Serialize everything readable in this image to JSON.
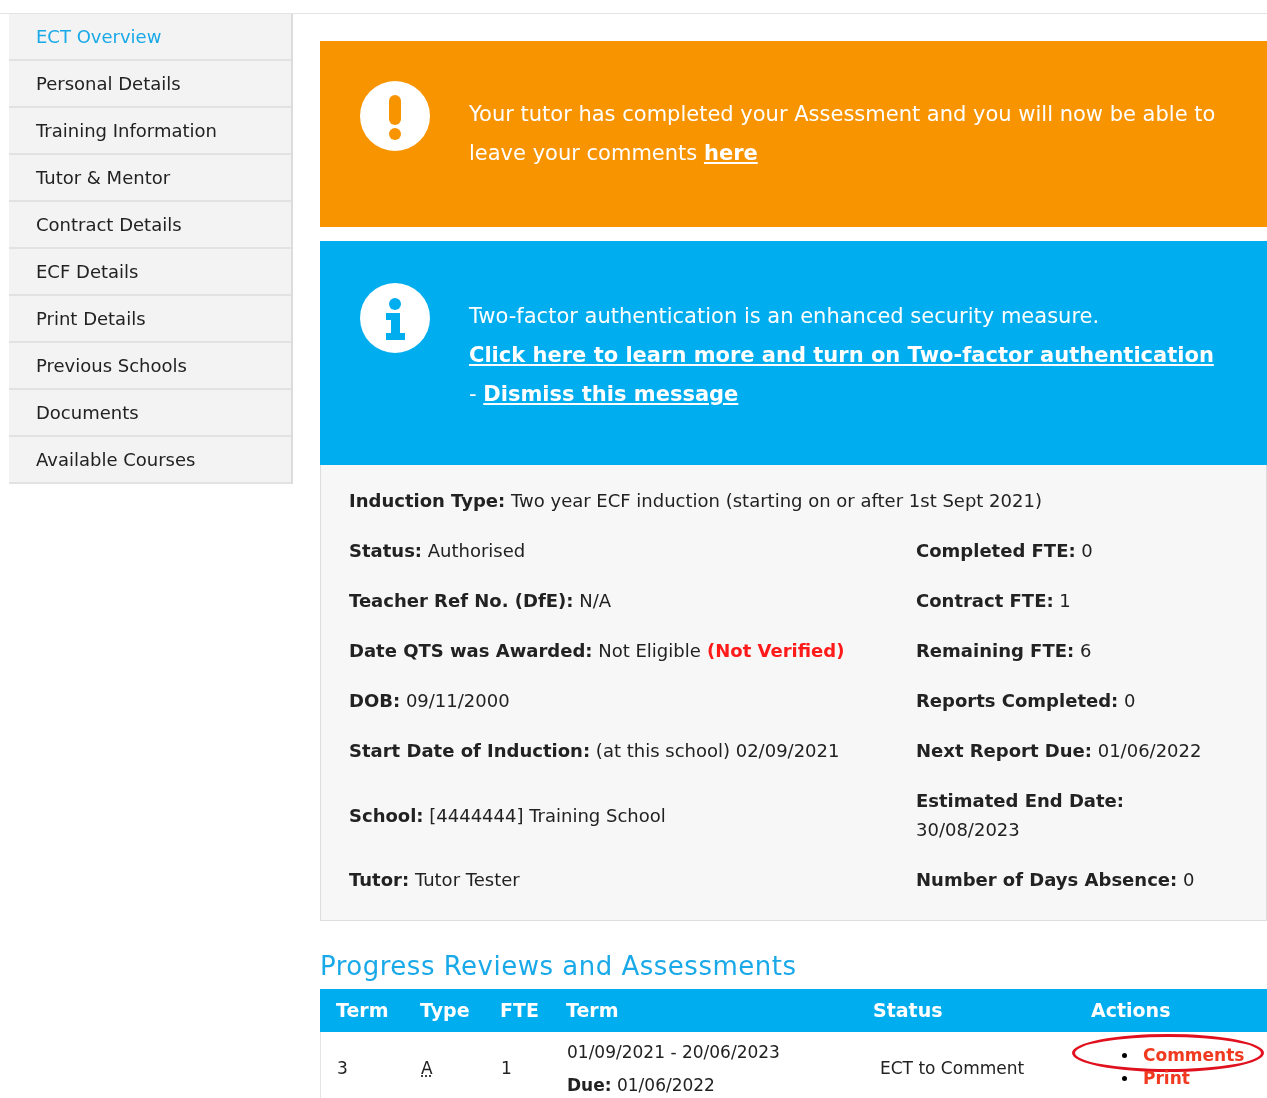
{
  "sidebar": {
    "items": [
      {
        "label": "ECT Overview",
        "selected": true
      },
      {
        "label": "Personal Details",
        "selected": false
      },
      {
        "label": "Training Information",
        "selected": false
      },
      {
        "label": "Tutor & Mentor",
        "selected": false
      },
      {
        "label": "Contract Details",
        "selected": false
      },
      {
        "label": "ECF Details",
        "selected": false
      },
      {
        "label": "Print Details",
        "selected": false
      },
      {
        "label": "Previous Schools",
        "selected": false
      },
      {
        "label": "Documents",
        "selected": false
      },
      {
        "label": "Available Courses",
        "selected": false
      }
    ]
  },
  "alerts": [
    {
      "kind": "warning",
      "segments": [
        {
          "text": "Your tutor has completed your Assessment and you will now be able to leave your comments ",
          "link": false
        },
        {
          "text": "here",
          "link": true
        }
      ]
    },
    {
      "kind": "info",
      "segments": [
        {
          "text": "Two-factor authentication is an enhanced security measure. ",
          "link": false
        },
        {
          "text": "Click here to learn more and turn on Two-factor authentication",
          "link": true
        },
        {
          "text": " - ",
          "link": false
        },
        {
          "text": "Dismiss this message",
          "link": true
        }
      ]
    }
  ],
  "details": {
    "full": {
      "label": "Induction Type:",
      "value": "Two year ECF induction (starting on or after 1st Sept 2021)"
    },
    "rows": [
      {
        "left": {
          "label": "Status:",
          "value": "Authorised"
        },
        "right": {
          "label": "Completed FTE:",
          "value": "0"
        }
      },
      {
        "left": {
          "label": "Teacher Ref No. (DfE):",
          "value": "N/A"
        },
        "right": {
          "label": "Contract FTE:",
          "value": "1"
        }
      },
      {
        "left": {
          "label": "Date QTS was Awarded:",
          "value": "Not Eligible",
          "note": "(Not Verified)"
        },
        "right": {
          "label": "Remaining FTE:",
          "value": "6"
        }
      },
      {
        "left": {
          "label": "DOB:",
          "value": "09/11/2000"
        },
        "right": {
          "label": "Reports Completed:",
          "value": "0"
        }
      },
      {
        "left": {
          "label": "Start Date of Induction:",
          "value": "(at this school) 02/09/2021"
        },
        "right": {
          "label": "Next Report Due:",
          "value": "01/06/2022"
        }
      },
      {
        "left": {
          "label": "School:",
          "value": "[4444444] Training School"
        },
        "right": {
          "label": "Estimated End Date:",
          "value": "30/08/2023"
        }
      },
      {
        "left": {
          "label": "Tutor:",
          "value": "Tutor Tester"
        },
        "right": {
          "label": "Number of Days Absence:",
          "value": "0"
        }
      }
    ]
  },
  "progress": {
    "heading": "Progress Reviews and Assessments",
    "columns": [
      "Term",
      "Type",
      "FTE",
      "Term",
      "Status",
      "Actions"
    ],
    "rows": [
      {
        "term": "3",
        "type": "A",
        "fte": "1",
        "period": "01/09/2021 - 20/06/2023",
        "due_label": "Due:",
        "due": "01/06/2022",
        "status": "ECT to Comment",
        "actions": [
          {
            "label": "Comments",
            "highlighted": true
          },
          {
            "label": "Print",
            "highlighted": false
          }
        ]
      }
    ]
  }
}
